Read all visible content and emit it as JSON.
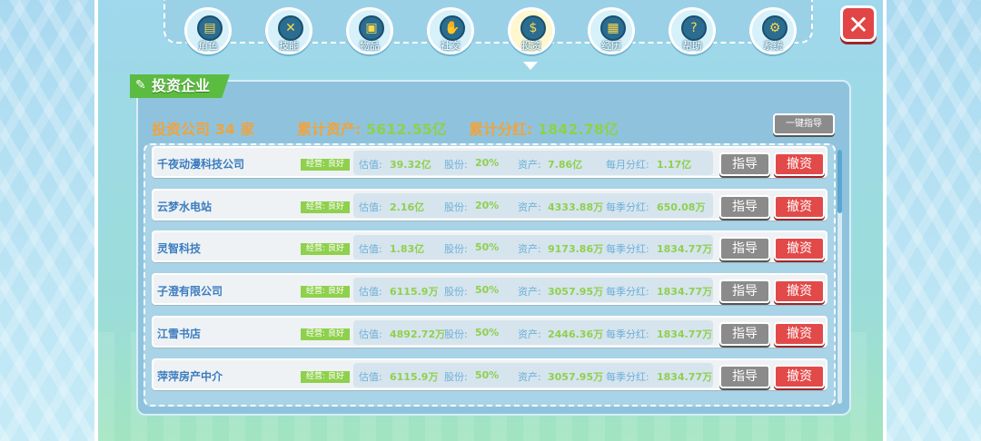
{
  "nav": {
    "items": [
      {
        "label": "角色",
        "icon": "id-card-icon",
        "glyph": "▤"
      },
      {
        "label": "技能",
        "icon": "crossed-swords-icon",
        "glyph": "✕"
      },
      {
        "label": "物品",
        "icon": "bag-icon",
        "glyph": "▣"
      },
      {
        "label": "社交",
        "icon": "handshake-icon",
        "glyph": "✋"
      },
      {
        "label": "投资",
        "icon": "coin-hand-icon",
        "glyph": "$"
      },
      {
        "label": "经历",
        "icon": "calendar-icon",
        "glyph": "▦"
      },
      {
        "label": "帮助",
        "icon": "question-icon",
        "glyph": "?"
      },
      {
        "label": "系统",
        "icon": "gear-icon",
        "glyph": "⚙"
      }
    ],
    "active_index": 4
  },
  "close_glyph": "✕",
  "tab_title": "投资企业",
  "summary": {
    "company_label": "投资公司",
    "company_count": "34",
    "company_unit": "家",
    "assets_label": "累计资产:",
    "assets_value": "5612.55亿",
    "dividend_label": "累计分红:",
    "dividend_value": "1842.78亿"
  },
  "one_click_label": "一键指导",
  "labels": {
    "valuation": "估值:",
    "shares": "股份:",
    "assets": "资产:",
    "guide": "指导",
    "withdraw": "撤资"
  },
  "companies": [
    {
      "name": "千夜动漫科技公司",
      "status": "经营: 良好",
      "valuation": "39.32亿",
      "shares": "20%",
      "assets": "7.86亿",
      "dividend_label": "每月分红:",
      "dividend": "1.17亿"
    },
    {
      "name": "云梦水电站",
      "status": "经营: 良好",
      "valuation": "2.16亿",
      "shares": "20%",
      "assets": "4333.88万",
      "dividend_label": "每季分红:",
      "dividend": "650.08万"
    },
    {
      "name": "灵智科技",
      "status": "经营: 良好",
      "valuation": "1.83亿",
      "shares": "50%",
      "assets": "9173.86万",
      "dividend_label": "每季分红:",
      "dividend": "1834.77万"
    },
    {
      "name": "子澄有限公司",
      "status": "经营: 良好",
      "valuation": "6115.9万",
      "shares": "50%",
      "assets": "3057.95万",
      "dividend_label": "每季分红:",
      "dividend": "1834.77万"
    },
    {
      "name": "江雪书店",
      "status": "经营: 良好",
      "valuation": "4892.72万",
      "shares": "50%",
      "assets": "2446.36万",
      "dividend_label": "每季分红:",
      "dividend": "1834.77万"
    },
    {
      "name": "萍萍房产中介",
      "status": "经营: 良好",
      "valuation": "6115.9万",
      "shares": "50%",
      "assets": "3057.95万",
      "dividend_label": "每季分红:",
      "dividend": "1834.77万"
    }
  ]
}
